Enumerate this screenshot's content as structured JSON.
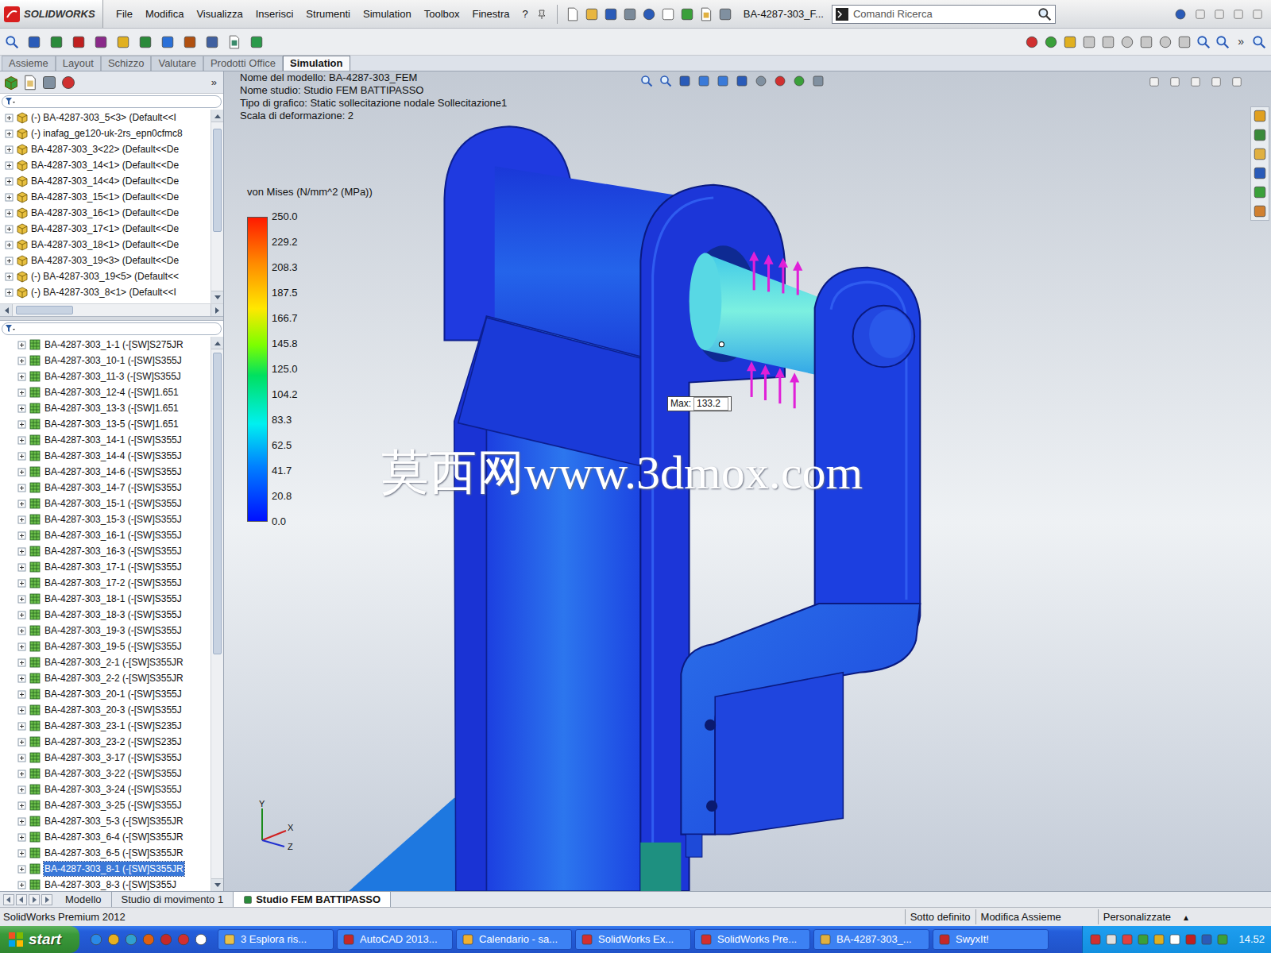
{
  "app": {
    "logo": "SOLIDWORKS",
    "menu": [
      "File",
      "Modifica",
      "Visualizza",
      "Inserisci",
      "Strumenti",
      "Simulation",
      "Toolbox",
      "Finestra",
      "?"
    ],
    "document_title": "BA-4287-303_F...",
    "search_placeholder": "Comandi Ricerca",
    "toolbar_more": "»"
  },
  "command_tabs": [
    {
      "label": "Assieme",
      "selected": false
    },
    {
      "label": "Layout",
      "selected": false
    },
    {
      "label": "Schizzo",
      "selected": false
    },
    {
      "label": "Valutare",
      "selected": false
    },
    {
      "label": "Prodotti Office",
      "selected": false
    },
    {
      "label": "Simulation",
      "selected": true
    }
  ],
  "feature_tree": {
    "panel_more": "»",
    "upper": [
      "(-) BA-4287-303_5<3> (Default<<I",
      "(-) inafag_ge120-uk-2rs_epn0cfmc8",
      "BA-4287-303_3<22> (Default<<De",
      "BA-4287-303_14<1> (Default<<De",
      "BA-4287-303_14<4> (Default<<De",
      "BA-4287-303_15<1> (Default<<De",
      "BA-4287-303_16<1> (Default<<De",
      "BA-4287-303_17<1> (Default<<De",
      "BA-4287-303_18<1> (Default<<De",
      "BA-4287-303_19<3> (Default<<De",
      "(-) BA-4287-303_19<5> (Default<<",
      "(-) BA-4287-303_8<1> (Default<<I"
    ],
    "lower": [
      {
        "label": "BA-4287-303_1-1 (-[SW]S275JR",
        "selected": false
      },
      {
        "label": "BA-4287-303_10-1 (-[SW]S355J",
        "selected": false
      },
      {
        "label": "BA-4287-303_11-3 (-[SW]S355J",
        "selected": false
      },
      {
        "label": "BA-4287-303_12-4 (-[SW]1.651",
        "selected": false
      },
      {
        "label": "BA-4287-303_13-3 (-[SW]1.651",
        "selected": false
      },
      {
        "label": "BA-4287-303_13-5 (-[SW]1.651",
        "selected": false
      },
      {
        "label": "BA-4287-303_14-1 (-[SW]S355J",
        "selected": false
      },
      {
        "label": "BA-4287-303_14-4 (-[SW]S355J",
        "selected": false
      },
      {
        "label": "BA-4287-303_14-6 (-[SW]S355J",
        "selected": false
      },
      {
        "label": "BA-4287-303_14-7 (-[SW]S355J",
        "selected": false
      },
      {
        "label": "BA-4287-303_15-1 (-[SW]S355J",
        "selected": false
      },
      {
        "label": "BA-4287-303_15-3 (-[SW]S355J",
        "selected": false
      },
      {
        "label": "BA-4287-303_16-1 (-[SW]S355J",
        "selected": false
      },
      {
        "label": "BA-4287-303_16-3 (-[SW]S355J",
        "selected": false
      },
      {
        "label": "BA-4287-303_17-1 (-[SW]S355J",
        "selected": false
      },
      {
        "label": "BA-4287-303_17-2 (-[SW]S355J",
        "selected": false
      },
      {
        "label": "BA-4287-303_18-1 (-[SW]S355J",
        "selected": false
      },
      {
        "label": "BA-4287-303_18-3 (-[SW]S355J",
        "selected": false
      },
      {
        "label": "BA-4287-303_19-3 (-[SW]S355J",
        "selected": false
      },
      {
        "label": "BA-4287-303_19-5 (-[SW]S355J",
        "selected": false
      },
      {
        "label": "BA-4287-303_2-1 (-[SW]S355JR",
        "selected": false
      },
      {
        "label": "BA-4287-303_2-2 (-[SW]S355JR",
        "selected": false
      },
      {
        "label": "BA-4287-303_20-1 (-[SW]S355J",
        "selected": false
      },
      {
        "label": "BA-4287-303_20-3 (-[SW]S355J",
        "selected": false
      },
      {
        "label": "BA-4287-303_23-1 (-[SW]S235J",
        "selected": false
      },
      {
        "label": "BA-4287-303_23-2 (-[SW]S235J",
        "selected": false
      },
      {
        "label": "BA-4287-303_3-17 (-[SW]S355J",
        "selected": false
      },
      {
        "label": "BA-4287-303_3-22 (-[SW]S355J",
        "selected": false
      },
      {
        "label": "BA-4287-303_3-24 (-[SW]S355J",
        "selected": false
      },
      {
        "label": "BA-4287-303_3-25 (-[SW]S355J",
        "selected": false
      },
      {
        "label": "BA-4287-303_5-3 (-[SW]S355JR",
        "selected": false
      },
      {
        "label": "BA-4287-303_6-4 (-[SW]S355JR",
        "selected": false
      },
      {
        "label": "BA-4287-303_6-5 (-[SW]S355JR",
        "selected": false
      },
      {
        "label": "BA-4287-303_8-1 (-[SW]S355JR",
        "selected": true
      },
      {
        "label": "BA-4287-303_8-3 (-[SW]S355J",
        "selected": false
      }
    ]
  },
  "plot": {
    "info": [
      "Nome del modello: BA-4287-303_FEM",
      "Nome studio: Studio FEM BATTIPASSO",
      "Tipo di grafico: Static sollecitazione nodale Sollecitazione1",
      "Scala di deformazione: 2"
    ],
    "legend": {
      "title": "von Mises (N/mm^2 (MPa))",
      "ticks": [
        "250.0",
        "229.2",
        "208.3",
        "187.5",
        "166.7",
        "145.8",
        "125.0",
        "104.2",
        "83.3",
        "62.5",
        "41.7",
        "20.8",
        "0.0"
      ]
    },
    "max_label": {
      "label": "Max:",
      "value": "133.2"
    },
    "watermark": "莫西网www.3dmox.com",
    "axes": [
      "Y",
      "X",
      "Z"
    ]
  },
  "bottom_tabs": [
    {
      "label": "Modello",
      "selected": false
    },
    {
      "label": "Studio di movimento 1",
      "selected": false
    },
    {
      "label": "Studio FEM BATTIPASSO",
      "selected": true
    }
  ],
  "status_bar": {
    "product": "SolidWorks Premium 2012",
    "items": [
      "Sotto definito",
      "Modifica Assieme",
      "Personalizzate"
    ],
    "menu_glyph": "▴"
  },
  "taskbar": {
    "start": "start",
    "items": [
      {
        "label": "3 Esplora ris...",
        "color": "#e8c14a"
      },
      {
        "label": "AutoCAD 2013...",
        "color": "#c62828"
      },
      {
        "label": "Calendario - sa...",
        "color": "#f0b030"
      },
      {
        "label": "SolidWorks Ex...",
        "color": "#d32f2f"
      },
      {
        "label": "SolidWorks Pre...",
        "color": "#d32f2f"
      },
      {
        "label": "BA-4287-303_...",
        "color": "#e0b040"
      },
      {
        "label": "SwyxIt!",
        "color": "#c62828"
      }
    ],
    "clock": "14.52"
  }
}
